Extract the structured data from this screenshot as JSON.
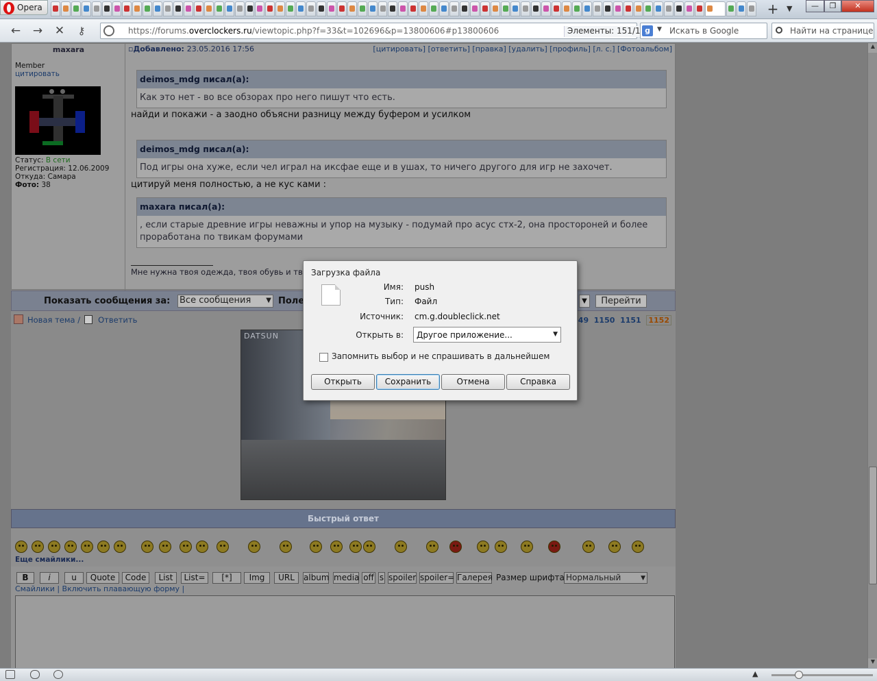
{
  "browser": {
    "app_name": "Opera",
    "address_url_prefix": "https://forums.",
    "address_url_domain": "overclockers.ru",
    "address_url_path": "/viewtopic.php?f=33&t=102696&p=13800606#p13800606",
    "elements_counter": "Элементы:   151/15",
    "search_engine_placeholder": "Искать в Google",
    "find_in_page_placeholder": "Найти на странице"
  },
  "post": {
    "author": "maxara",
    "role": "Member",
    "quote_link": "цитировать",
    "status_label": "Статус: ",
    "status_value": "В сети",
    "registration": "Регистрация: 12.06.2009",
    "location": "Откуда: Самара",
    "photo_label": "Фото:",
    "photo_value": " 38",
    "added_label": "Добавлено: ",
    "added_date": "23.05.2016 17:56",
    "actions": "[цитировать] [ответить] [правка] [удалить] [профиль] [л. с.] [Фотоальбом]",
    "quotes": [
      {
        "header": "deimos_mdg писал(а):",
        "body": "Как это нет - во все обзорах про него пишут что есть."
      },
      {
        "header": "deimos_mdg писал(а):",
        "body": "Под игры она хуже, если чел играл на иксфае еще и в ушах, то ничего другого для игр не захочет."
      },
      {
        "header": "maxara писал(а):",
        "body": ", если старые древние игры неважны и упор на музыку - подумай про асус стх-2, она простороней и более проработана по твикам форумами"
      }
    ],
    "replies": [
      "найди и покажи - а заодно объясни разницу между буфером и усилком",
      "цитируй меня полностью, а не кус ками :"
    ],
    "signature": "Мне нужна твоя одежда, твоя обувь и тво"
  },
  "show_bar": {
    "label": "Показать сообщения за:",
    "select_value": "Все сообщения",
    "label2": "Поле",
    "go_button": "Перейти"
  },
  "topic_actions": {
    "new_topic": "Новая тема",
    "separator": " /",
    "reply": "Ответить"
  },
  "pagination": {
    "pages": [
      "1149",
      "1150",
      "1151"
    ],
    "current": "1152"
  },
  "image": {
    "caption_logo": "DATSUN"
  },
  "quick_reply": {
    "header": "Быстрый ответ",
    "more_smilies": "Еще смайлики...",
    "toolbar": [
      "B",
      "i",
      "u",
      "Quote",
      "Code",
      "List",
      "List=",
      "[*]",
      "Img",
      "URL",
      "album",
      "media",
      "off",
      "s",
      "spoiler",
      "spoiler=",
      "Галерея"
    ],
    "font_size_label": "Размер шрифта:",
    "font_size_value": "Нормальный",
    "links": "Смайлики | Включить плавающую форму |"
  },
  "dialog": {
    "title": "Загрузка файла",
    "name_label": "Имя:",
    "name_value": "push",
    "type_label": "Тип:",
    "type_value": "Файл",
    "source_label": "Источник:",
    "source_value": "cm.g.doubleclick.net",
    "open_in_label": "Открыть в:",
    "open_in_value": "Другое приложение...",
    "remember_label": "Запомнить выбор и не спрашивать в дальнейшем",
    "buttons": {
      "open": "Открыть",
      "save": "Сохранить",
      "cancel": "Отмена",
      "help": "Справка"
    }
  },
  "colors": {
    "dialog_default_border": "#3c7fb1",
    "online_status": "#1d6a1d",
    "current_page": "#9a4a00"
  }
}
